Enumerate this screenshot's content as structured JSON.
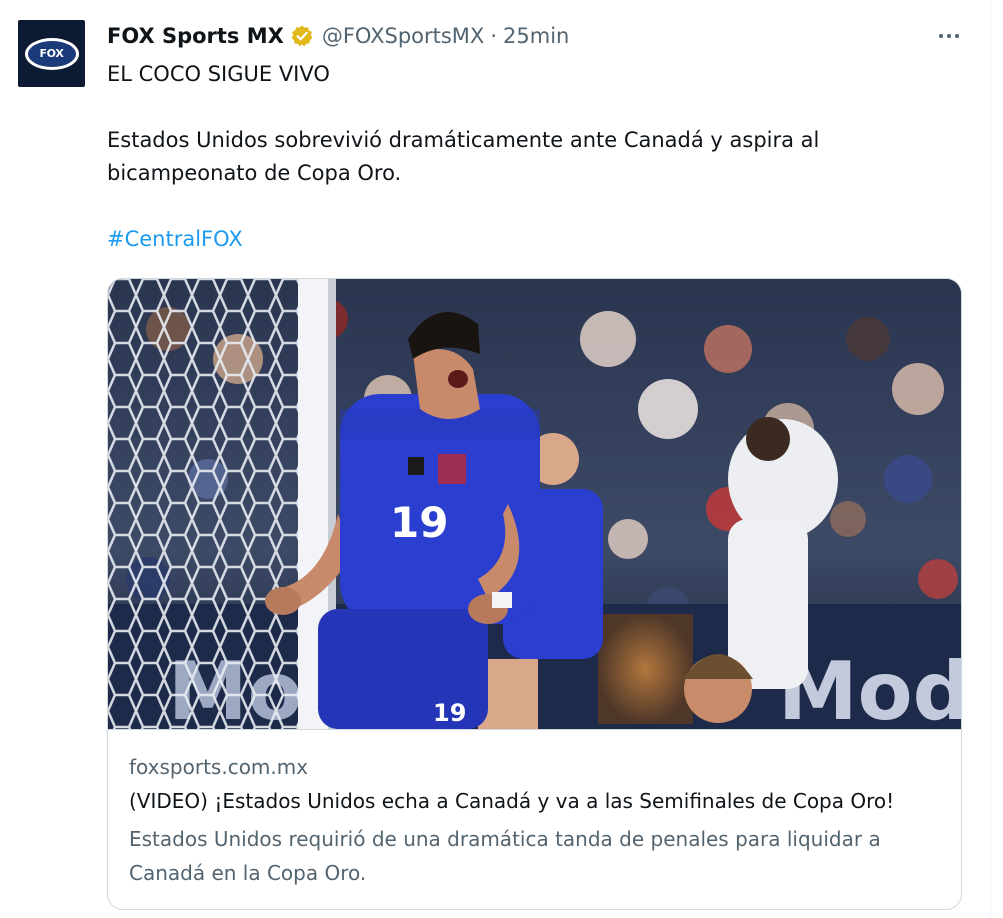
{
  "author": {
    "avatar_text": "FOX",
    "display_name": "FOX Sports MX",
    "handle": "@FOXSportsMX",
    "separator": "·",
    "time": "25min",
    "verified_color": "#e2b719"
  },
  "tweet": {
    "line1": "EL COCO SIGUE VIVO",
    "line2": "Estados Unidos sobrevivió dramáticamente ante Canadá y aspira al bicampeonato de Copa Oro.",
    "hashtag": "#CentralFOX"
  },
  "card": {
    "image_ad_text": "Mode",
    "player_number": "19",
    "domain": "foxsports.com.mx",
    "title": "(VIDEO) ¡Estados Unidos echa a Canadá y va a las Semifinales de Copa Oro!",
    "description": "Estados Unidos requirió de una dramática tanda de penales para liquidar a Canadá en la Copa Oro."
  },
  "colors": {
    "text_primary": "#0f1419",
    "text_secondary": "#536471",
    "link": "#1d9bf0",
    "border": "#cfd9de",
    "jersey_blue": "#2a3fd0"
  }
}
